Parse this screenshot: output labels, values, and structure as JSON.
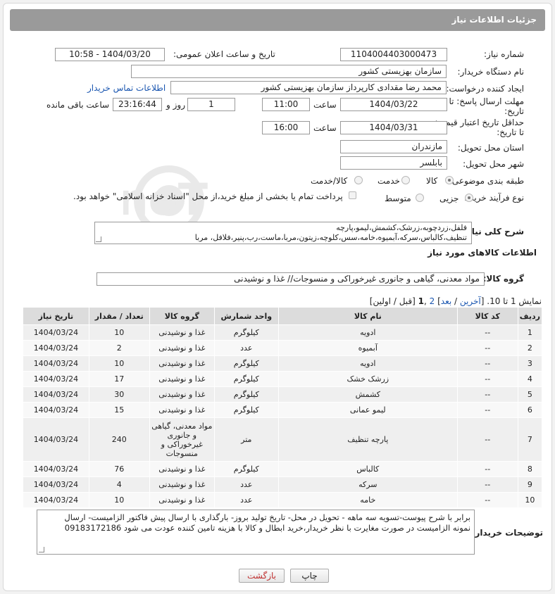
{
  "header": {
    "title": "جزئیات اطلاعات نیاز"
  },
  "form": {
    "need_number_label": "شماره نیاز:",
    "need_number": "1104004403000473",
    "announce_label": "تاریخ و ساعت اعلان عمومی:",
    "announce_value": "1404/03/20 - 10:58",
    "buyer_org_label": "نام دستگاه خریدار:",
    "buyer_org": "سازمان بهزیستی کشور",
    "creator_label": "ایجاد کننده درخواست:",
    "creator": "محمد رضا  مقدادی کارپرداز سازمان بهزیستی کشور",
    "contact_link": "اطلاعات تماس خریدار",
    "deadline_label_1": "مهلت ارسال پاسخ: تا",
    "deadline_label_2": "تاریخ:",
    "deadline_date": "1404/03/22",
    "time_label": "ساعت",
    "deadline_time": "11:00",
    "days_value": "1",
    "days_label": "روز و",
    "remaining_value": "23:16:44",
    "remaining_label": "ساعت باقی مانده",
    "price_valid_label_1": "حداقل تاریخ اعتبار قیمت:",
    "price_valid_label_2": "تا تاریخ:",
    "price_valid_date": "1404/03/31",
    "price_valid_time": "16:00",
    "province_label": "استان محل تحویل:",
    "province": "مازندران",
    "city_label": "شهر محل تحویل:",
    "city": "بابلسر",
    "category_label": "طبقه بندی موضوعی:",
    "category_options": [
      "کالا",
      "خدمت",
      "کالا/خدمت"
    ],
    "process_label": "نوع فرآیند خرید :",
    "process_options": [
      "جزیی",
      "متوسط"
    ],
    "payment_note": "پرداخت تمام یا بخشی از مبلغ خرید،از محل \"اسناد خزانه اسلامی\" خواهد بود.",
    "desc_label": "شرح کلی نیاز:",
    "desc_line1": "فلفل،زردچوبه،زرشک،کشمش،لیمو،پارچه",
    "desc_line2": "تنظیف،کالباس،سرکه،آبمیوه،خامه،سس،کلوچه،زیتون،مربا،ماست،رب،پنیر،فلافل، مربا"
  },
  "goods": {
    "section_title": "اطلاعات کالاهای مورد نیاز",
    "group_label": "گروه کالا:",
    "group_value": "مواد معدنی، گیاهی و جانوری غیرخوراکی و منسوجات// غذا و نوشیدنی",
    "paging": {
      "show": "نمایش 1 تا 10. [",
      "last": "آخرین",
      "sep1": " / ",
      "next": "بعد",
      "sep2": "] ",
      "page2": "2",
      "comma": " ,",
      "page1": "1",
      "tail": " [قبل / اولین]"
    },
    "columns": [
      "ردیف",
      "کد کالا",
      "نام کالا",
      "واحد شمارش",
      "گروه کالا",
      "تعداد / مقدار",
      "تاریخ نیاز"
    ],
    "rows": [
      [
        "1",
        "--",
        "ادویه",
        "کیلوگرم",
        "غذا و نوشیدنی",
        "10",
        "1404/03/24"
      ],
      [
        "2",
        "--",
        "آبمیوه",
        "عدد",
        "غذا و نوشیدنی",
        "2",
        "1404/03/24"
      ],
      [
        "3",
        "--",
        "ادویه",
        "کیلوگرم",
        "غذا و نوشیدنی",
        "10",
        "1404/03/24"
      ],
      [
        "4",
        "--",
        "زرشک خشک",
        "کیلوگرم",
        "غذا و نوشیدنی",
        "17",
        "1404/03/24"
      ],
      [
        "5",
        "--",
        "کشمش",
        "کیلوگرم",
        "غذا و نوشیدنی",
        "30",
        "1404/03/24"
      ],
      [
        "6",
        "--",
        "لیمو عمانی",
        "کیلوگرم",
        "غذا و نوشیدنی",
        "15",
        "1404/03/24"
      ],
      [
        "7",
        "--",
        "پارچه تنظیف",
        "متر",
        "مواد معدنی، گیاهی و جانوری غیرخوراکی و منسوجات",
        "240",
        "1404/03/24"
      ],
      [
        "8",
        "--",
        "کالباس",
        "کیلوگرم",
        "غذا و نوشیدنی",
        "76",
        "1404/03/24"
      ],
      [
        "9",
        "--",
        "سرکه",
        "عدد",
        "غذا و نوشیدنی",
        "4",
        "1404/03/24"
      ],
      [
        "10",
        "--",
        "خامه",
        "عدد",
        "غذا و نوشیدنی",
        "10",
        "1404/03/24"
      ]
    ]
  },
  "buyer_notes": {
    "label": "توضیحات خریدار:",
    "line1": "برابر با شرح پیوست-تسویه سه ماهه - تحویل در محل- تاریخ تولید بروز- بارگذاری با ارسال پیش فاکتور الزامیست- ارسال",
    "line2": "نمونه الزامیست در صورت مغایرت با نظر خریدار،خرید ابطال و کالا با هزینه تامین کننده عودت می شود 09183172186"
  },
  "buttons": {
    "print": "چاپ",
    "back": "بازگشت"
  },
  "watermark_text": "AriaTender.neT"
}
